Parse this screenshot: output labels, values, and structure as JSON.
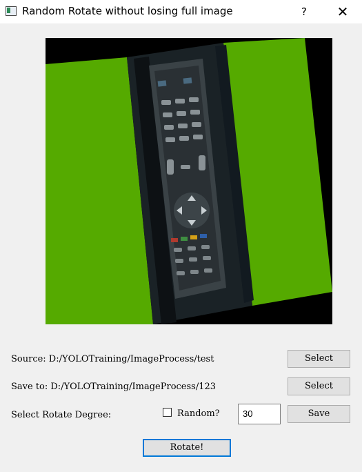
{
  "window": {
    "title": "Random Rotate without losing full image",
    "help_label": "?",
    "close_label": "✕",
    "icon": "app-icon"
  },
  "colors": {
    "fill_green": "#55aa00",
    "window_bg": "#f0f0f0",
    "accent_border": "#0078d7"
  },
  "preview": {
    "description_icon": "rotated-photo-remote-control"
  },
  "source": {
    "label": "Source: D:/YOLOTraining/ImageProcess/test",
    "button_label": "Select"
  },
  "save_to": {
    "label": "Save to: D:/YOLOTraining/ImageProcess/123",
    "button_label": "Select"
  },
  "rotate": {
    "degree_label": "Select Rotate Degree:",
    "random_label": "Random?",
    "random_checked": false,
    "degree_value": "30",
    "save_label": "Save",
    "rotate_label": "Rotate!"
  }
}
